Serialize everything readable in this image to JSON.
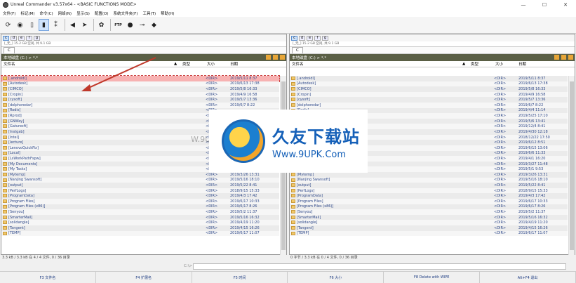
{
  "window": {
    "title": "Unreal Commander v3.57x64 - <BASIC FUNCTIONS MODE>"
  },
  "menu": [
    "文件(F)",
    "标记(M)",
    "命令(C)",
    "网络(N)",
    "显示(S)",
    "配置(O)",
    "系统文件夹(F)",
    "工具(T)",
    "帮助(H)"
  ],
  "left": {
    "drive_info": "[_无_]  15.2 GB 空闲, 共 9.1 GB",
    "tab": "C",
    "path": "本地磁盘 (C:) > *.*",
    "headers": {
      "name": "文件名",
      "type": "类型",
      "size": "大小",
      "date": "日期"
    },
    "rows": [
      {
        "name": "[.androidl]",
        "size": "<DIR>",
        "date": "2019/5/11 8:37"
      },
      {
        "name": "[Autodesk]",
        "size": "<DIR>",
        "date": "2019/6/13 17:38"
      },
      {
        "name": "[CIMCO]",
        "size": "<DIR>",
        "date": "2019/5/8 16:33"
      },
      {
        "name": "[Cropin]",
        "size": "<DIR>",
        "date": "2019/4/9 16:58"
      },
      {
        "name": "[cysoft]",
        "size": "<DIR>",
        "date": "2019/5/7 13:36"
      },
      {
        "name": "[dolphoredar]",
        "size": "<DIR>",
        "date": "2019/6/7 8:22"
      },
      {
        "name": "[Rodis]",
        "size": "<DIR>",
        "date": ""
      },
      {
        "name": "[Rprod]",
        "size": "<DIR>",
        "date": ""
      },
      {
        "name": "[GNWay]",
        "size": "<DIR>",
        "date": ""
      },
      {
        "name": "[Gaturesft]",
        "size": "<DIR>",
        "date": ""
      },
      {
        "name": "[Instgab]",
        "size": "<DIR>",
        "date": ""
      },
      {
        "name": "[Intel]",
        "size": "<DIR>",
        "date": ""
      },
      {
        "name": "[lecture]",
        "size": "<DIR>",
        "date": ""
      },
      {
        "name": "[LenovoQuickFix]",
        "size": "<DIR>",
        "date": ""
      },
      {
        "name": "[Local]",
        "size": "<DIR>",
        "date": ""
      },
      {
        "name": "[LsWorkPathFspw]",
        "size": "<DIR>",
        "date": ""
      },
      {
        "name": "[My Documents]",
        "size": "<DIR>",
        "date": ""
      },
      {
        "name": "[My Tasks]",
        "size": "<DIR>",
        "date": "2019/5/1 9:53"
      },
      {
        "name": "[Mytemp]",
        "size": "<DIR>",
        "date": "2019/3/26 13:31"
      },
      {
        "name": "[Nanjing Swansoft]",
        "size": "<DIR>",
        "date": "2019/5/16 18:10"
      },
      {
        "name": "[output]",
        "size": "<DIR>",
        "date": "2019/5/22 8:41"
      },
      {
        "name": "[PerfLogs]",
        "size": "<DIR>",
        "date": "2018/9/15 15:33"
      },
      {
        "name": "[ProgramData]",
        "size": "<DIR>",
        "date": "2019/4/3 17:42"
      },
      {
        "name": "[Program Files]",
        "size": "<DIR>",
        "date": "2019/6/17 10:33"
      },
      {
        "name": "[Program Files (x86)]",
        "size": "<DIR>",
        "date": "2019/6/17 8:26"
      },
      {
        "name": "[Senyou]",
        "size": "<DIR>",
        "date": "2019/5/2 11:37"
      },
      {
        "name": "[SmarterMail]",
        "size": "<DIR>",
        "date": "2019/5/16 16:32"
      },
      {
        "name": "[solidangle]",
        "size": "<DIR>",
        "date": "2019/4/19 11:20"
      },
      {
        "name": "[Tangent]",
        "size": "<DIR>",
        "date": "2019/4/15 16:26"
      },
      {
        "name": "[TEMP]",
        "size": "<DIR>",
        "date": "2019/6/17 11:07"
      }
    ],
    "status": "3.3 kB / 3.3 kB 在 4 / 4 文件, 0 / 36 目录"
  },
  "right": {
    "drive_info": "[_无_]  15.2 GB 空闲, 共 9.1 GB",
    "tab": "C",
    "path": "本地磁盘 (C:) > *.*",
    "headers": {
      "name": "文件名",
      "type": "类型",
      "size": "大小",
      "date": "日期"
    },
    "rows": [
      {
        "name": "[.androidl]",
        "size": "<DIR>",
        "date": "2019/5/11 8:37"
      },
      {
        "name": "[Autodesk]",
        "size": "<DIR>",
        "date": "2019/6/13 17:38"
      },
      {
        "name": "[CIMCO]",
        "size": "<DIR>",
        "date": "2019/5/8 16:33"
      },
      {
        "name": "[Cropin]",
        "size": "<DIR>",
        "date": "2019/4/9 16:58"
      },
      {
        "name": "[cysoft]",
        "size": "<DIR>",
        "date": "2019/5/7 13:36"
      },
      {
        "name": "[dolphoredar]",
        "size": "<DIR>",
        "date": "2019/6/7 8:22"
      },
      {
        "name": "[Rodis]",
        "size": "<DIR>",
        "date": "2019/4/4 11:14"
      },
      {
        "name": "[Rprod]",
        "size": "<DIR>",
        "date": "2019/5/25 17:10"
      },
      {
        "name": "[GNWay]",
        "size": "<DIR>",
        "date": "2019/5/6 13:41"
      },
      {
        "name": "[Gaturesft]",
        "size": "<DIR>",
        "date": "2019/12/4 8:41"
      },
      {
        "name": "[Instgab]",
        "size": "<DIR>",
        "date": "2019/4/30 12:18"
      },
      {
        "name": "[Intel]",
        "size": "<DIR>",
        "date": "2018/12/22 17:50"
      },
      {
        "name": "[lecture]",
        "size": "<DIR>",
        "date": "2019/6/12 8:51"
      },
      {
        "name": "[LenovoQuickFix]",
        "size": "<DIR>",
        "date": "2019/6/15 13:06"
      },
      {
        "name": "[Local]",
        "size": "<DIR>",
        "date": "2019/6/6 11:33"
      },
      {
        "name": "[LsWorkPathFspw]",
        "size": "<DIR>",
        "date": "2019/4/1 16:20"
      },
      {
        "name": "[My Documents]",
        "size": "<DIR>",
        "date": "2019/3/27 11:48"
      },
      {
        "name": "[My Tasks]",
        "size": "<DIR>",
        "date": "2019/5/1 9:53"
      },
      {
        "name": "[Mytemp]",
        "size": "<DIR>",
        "date": "2019/3/26 13:31"
      },
      {
        "name": "[Nanjing Swansoft]",
        "size": "<DIR>",
        "date": "2019/5/16 18:10"
      },
      {
        "name": "[output]",
        "size": "<DIR>",
        "date": "2019/5/22 8:41"
      },
      {
        "name": "[PerfLogs]",
        "size": "<DIR>",
        "date": "2018/9/15 15:33"
      },
      {
        "name": "[ProgramData]",
        "size": "<DIR>",
        "date": "2019/4/3 17:42"
      },
      {
        "name": "[Program Files]",
        "size": "<DIR>",
        "date": "2019/6/17 10:33"
      },
      {
        "name": "[Program Files (x86)]",
        "size": "<DIR>",
        "date": "2019/6/17 8:26"
      },
      {
        "name": "[Senyou]",
        "size": "<DIR>",
        "date": "2019/5/2 11:37"
      },
      {
        "name": "[SmarterMail]",
        "size": "<DIR>",
        "date": "2019/5/16 16:32"
      },
      {
        "name": "[solidangle]",
        "size": "<DIR>",
        "date": "2019/4/19 11:20"
      },
      {
        "name": "[Tangent]",
        "size": "<DIR>",
        "date": "2019/4/15 16:26"
      },
      {
        "name": "[TEMP]",
        "size": "<DIR>",
        "date": "2019/6/17 11:07"
      }
    ],
    "status": "0 字节 / 3.3 kB 在 0 / 4 文件, 0 / 36 目录"
  },
  "cmdline": {
    "label": "C:\\>"
  },
  "fkeys": [
    "F3 文件名",
    "F4 扩展名",
    "F5 时间",
    "F6 大小",
    "F8 Delete with WIPE",
    "Alt+F4 退出"
  ],
  "watermark": {
    "logo_cn": "久友下载站",
    "logo_url": "Www.9UPK.Com",
    "overlay": "W.9UPK.COM"
  },
  "colors": {
    "pathbar": "#5a5f45",
    "selected_row": "#f7b2b2",
    "folder": "#f1c86a",
    "annotation_arrow": "#c0392b"
  }
}
